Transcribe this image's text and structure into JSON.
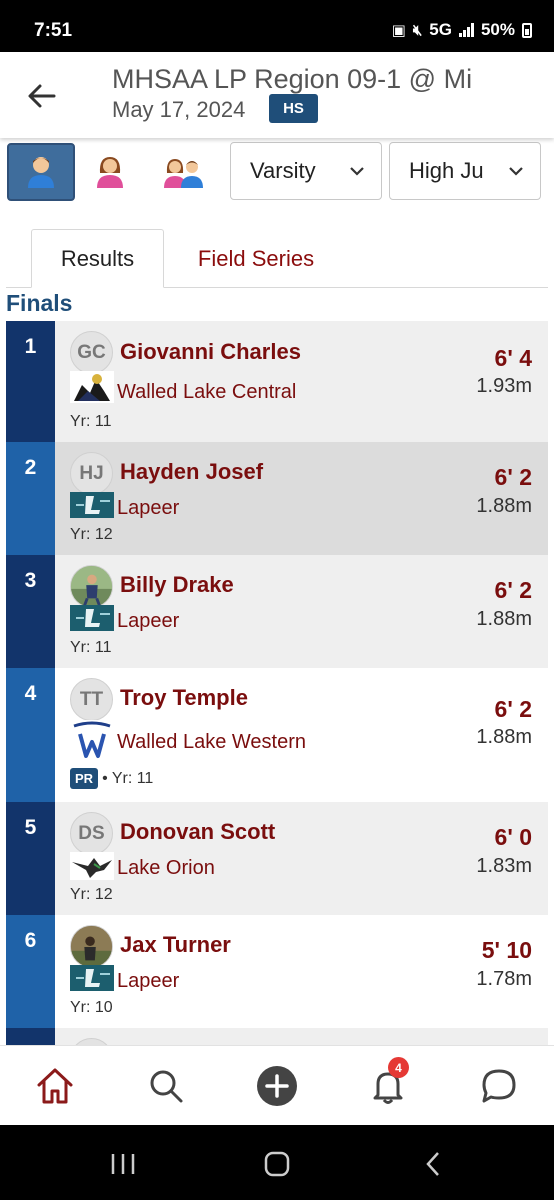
{
  "status_bar": {
    "time": "7:51",
    "network": "5G",
    "battery": "50%"
  },
  "header": {
    "title": "MHSAA LP Region 09-1 @ Mi",
    "date": "May 17, 2024",
    "level_badge": "HS"
  },
  "filters": {
    "gender_options": [
      "male-icon",
      "female-icon",
      "group-icon"
    ],
    "active_gender": "male",
    "division": "Varsity",
    "event": "High Ju"
  },
  "tabs": [
    {
      "label": "Results",
      "active": true
    },
    {
      "label": "Field Series",
      "active": false
    }
  ],
  "section_title": "Finals",
  "results": [
    {
      "place": "1",
      "initials": "GC",
      "name": "Giovanni Charles",
      "team": "Walled Lake Central",
      "meta": "Yr: 11",
      "pr": false,
      "mark": "6' 4",
      "metric": "1.93m"
    },
    {
      "place": "2",
      "initials": "HJ",
      "name": "Hayden Josef",
      "team": "Lapeer",
      "meta": "Yr: 12",
      "pr": false,
      "mark": "6' 2",
      "metric": "1.88m"
    },
    {
      "place": "3",
      "initials": "",
      "name": "Billy Drake",
      "team": "Lapeer",
      "meta": "Yr: 11",
      "pr": false,
      "mark": "6' 2",
      "metric": "1.88m"
    },
    {
      "place": "4",
      "initials": "TT",
      "name": "Troy Temple",
      "team": "Walled Lake Western",
      "meta": "• Yr: 11",
      "pr": true,
      "pr_label": "PR",
      "mark": "6' 2",
      "metric": "1.88m"
    },
    {
      "place": "5",
      "initials": "DS",
      "name": "Donovan Scott",
      "team": "Lake Orion",
      "meta": "Yr: 12",
      "pr": false,
      "mark": "6' 0",
      "metric": "1.83m"
    },
    {
      "place": "6",
      "initials": "",
      "name": "Jax Turner",
      "team": "Lapeer",
      "meta": "Yr: 10",
      "pr": false,
      "mark": "5' 10",
      "metric": "1.78m"
    }
  ],
  "bottom_nav": {
    "items": [
      "home-icon",
      "search-icon",
      "add-icon",
      "bell-icon",
      "chat-icon"
    ],
    "notification_count": "4"
  },
  "colors": {
    "brand_blue": "#1f4e79",
    "place_dark": "#12346b",
    "place_light": "#1f62a8",
    "name_red": "#7a0e0e",
    "row_gray": "#efefef",
    "row_white": "#ffffff",
    "row_selected": "#dcdcdc"
  }
}
